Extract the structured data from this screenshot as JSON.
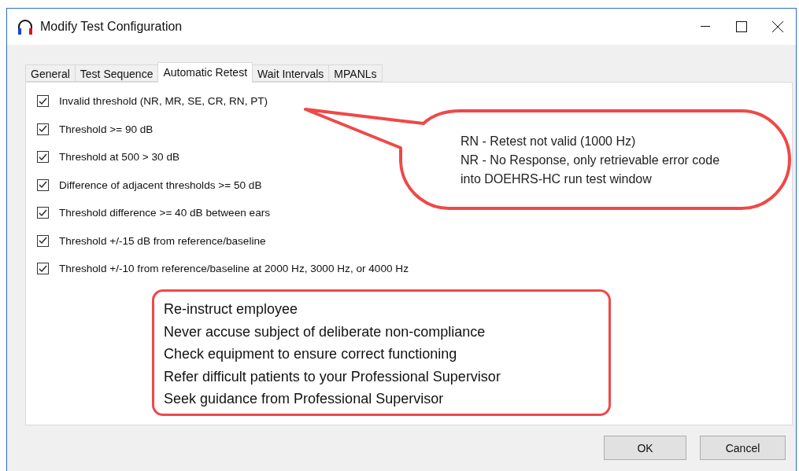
{
  "window": {
    "title": "Modify Test Configuration"
  },
  "tabs": [
    {
      "label": "General",
      "selected": false
    },
    {
      "label": "Test Sequence",
      "selected": false
    },
    {
      "label": "Automatic Retest",
      "selected": true
    },
    {
      "label": "Wait Intervals",
      "selected": false
    },
    {
      "label": "MPANLs",
      "selected": false
    }
  ],
  "options": [
    {
      "label": "Invalid threshold (NR, MR, SE, CR, RN, PT)",
      "checked": true
    },
    {
      "label": "Threshold >= 90 dB",
      "checked": true
    },
    {
      "label": "Threshold at 500 > 30 dB",
      "checked": true
    },
    {
      "label": "Difference of adjacent thresholds >= 50 dB",
      "checked": true
    },
    {
      "label": "Threshold difference >= 40 dB between ears",
      "checked": true
    },
    {
      "label": "Threshold +/-15 dB from reference/baseline",
      "checked": true
    },
    {
      "label": "Threshold +/-10 from reference/baseline at 2000 Hz, 3000 Hz, or 4000 Hz",
      "checked": true
    }
  ],
  "callout": {
    "lines": [
      "RN - Retest not valid (1000 Hz)",
      "NR - No Response, only retrievable error code into DOEHRS-HC run test window"
    ]
  },
  "notes": [
    "Re-instruct employee",
    "Never accuse subject of deliberate non-compliance",
    "Check equipment to ensure correct functioning",
    "Refer difficult patients to your Professional Supervisor",
    "Seek guidance from Professional Supervisor"
  ],
  "buttons": [
    "OK",
    "Cancel"
  ]
}
